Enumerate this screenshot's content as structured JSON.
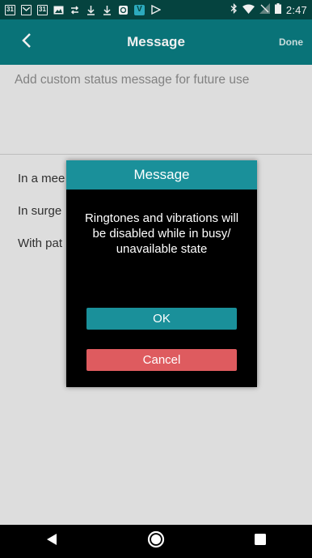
{
  "status_bar": {
    "time": "2:47",
    "left_icons": [
      "calendar-icon",
      "gmail-icon",
      "calendar-icon",
      "image-icon",
      "transfer-icon",
      "download-icon",
      "download-icon",
      "sync-icon",
      "app-icon",
      "play-icon"
    ],
    "calendar_day": "31",
    "app_icon_letter": "V",
    "right_icons": [
      "bluetooth-icon",
      "wifi-icon",
      "signal-icon",
      "battery-icon"
    ]
  },
  "app_bar": {
    "title": "Message",
    "done_label": "Done",
    "back_icon": "chevron-left-icon"
  },
  "custom_message": {
    "placeholder": "Add custom status message for future use",
    "value": ""
  },
  "preset_messages": [
    {
      "label": "In a mee"
    },
    {
      "label": "In surge"
    },
    {
      "label": "With pat"
    }
  ],
  "dialog": {
    "title": "Message",
    "message": "Ringtones and vibrations will be disabled while in busy/ unavailable state",
    "ok_label": "OK",
    "cancel_label": "Cancel"
  },
  "nav_bar": {
    "icons": [
      "back-triangle-icon",
      "home-circle-icon",
      "recents-square-icon"
    ]
  },
  "colors": {
    "status_bar": "#064843",
    "app_bar": "#0a7b80",
    "dialog_header": "#1a909a",
    "ok_button": "#1a909a",
    "cancel_button": "#de5b5f",
    "content_bg": "#ebebeb"
  }
}
